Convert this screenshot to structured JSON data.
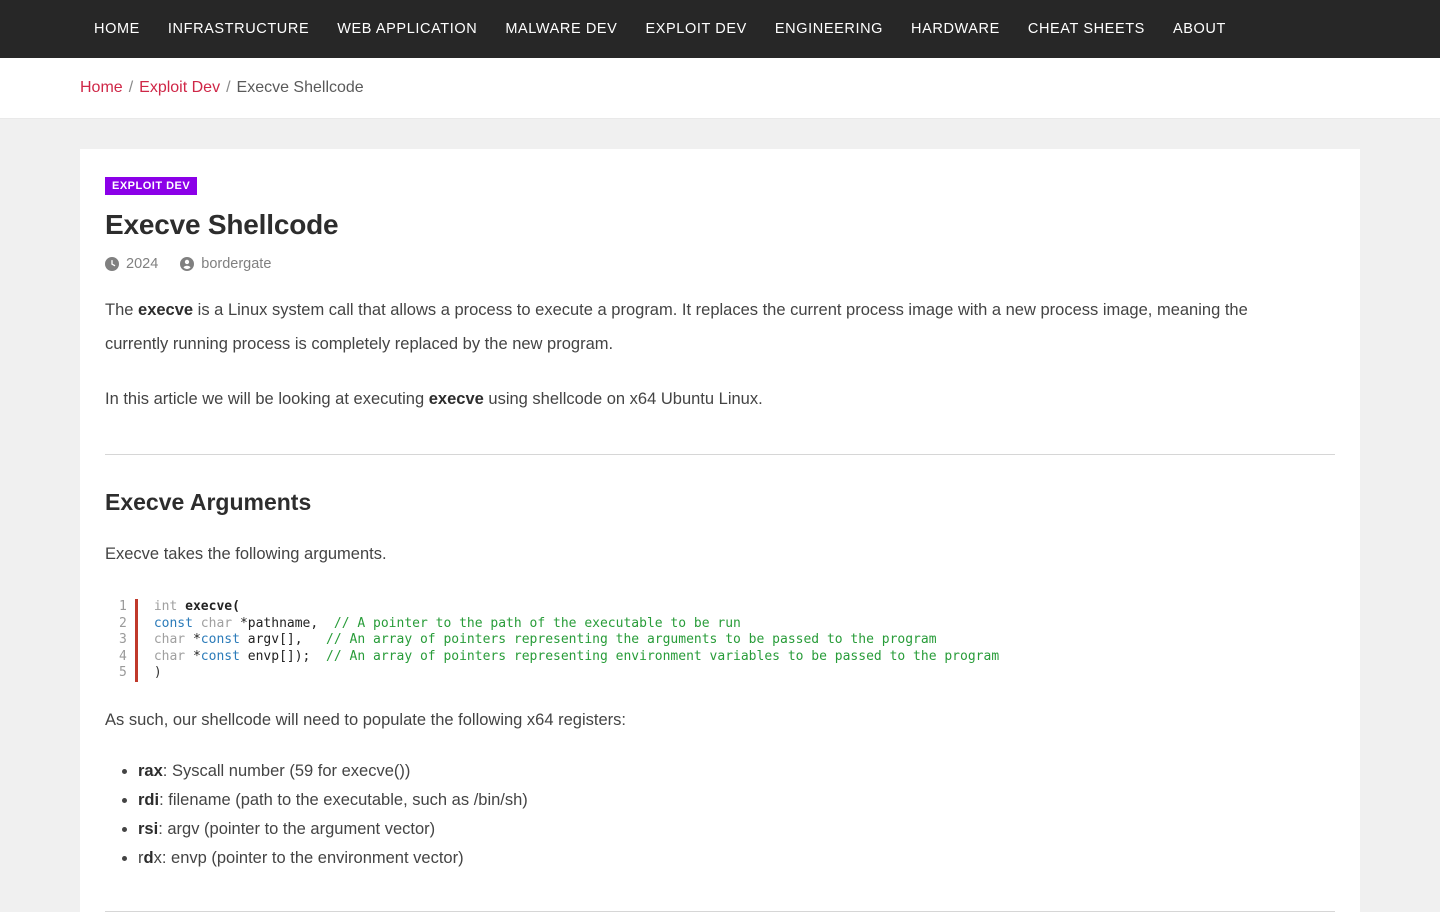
{
  "nav": {
    "items": [
      {
        "label": "Home",
        "name": "nav-item-home"
      },
      {
        "label": "Infrastructure",
        "name": "nav-item-infrastructure"
      },
      {
        "label": "Web Application",
        "name": "nav-item-web-application"
      },
      {
        "label": "Malware Dev",
        "name": "nav-item-malware-dev"
      },
      {
        "label": "Exploit Dev",
        "name": "nav-item-exploit-dev"
      },
      {
        "label": "Engineering",
        "name": "nav-item-engineering"
      },
      {
        "label": "Hardware",
        "name": "nav-item-hardware"
      },
      {
        "label": "Cheat Sheets",
        "name": "nav-item-cheat-sheets"
      },
      {
        "label": "About",
        "name": "nav-item-about"
      }
    ]
  },
  "breadcrumb": {
    "home": "Home",
    "sep1": "/",
    "category": "Exploit Dev",
    "sep2": "/",
    "current": "Execve Shellcode"
  },
  "article": {
    "badge": "EXPLOIT DEV",
    "title": "Execve Shellcode",
    "meta": {
      "date_icon": "clock-icon",
      "date": "2024",
      "author_icon": "user-icon",
      "author": "bordergate"
    },
    "intro": {
      "p1_a": "The ",
      "p1_b": "execve",
      "p1_c": " is a Linux system call that allows a process to execute a program. It replaces the current process image with a new process image, meaning the currently running process is completely replaced by the new program.",
      "p2_a": "In this article we will be looking at executing ",
      "p2_b": "execve",
      "p2_c": " using shellcode on x64 Ubuntu Linux."
    },
    "section": {
      "heading": "Execve Arguments",
      "lead": "Execve takes the following arguments.",
      "code": {
        "line_numbers": [
          "1",
          "2",
          "3",
          "4",
          "5"
        ],
        "lines": [
          [
            {
              "t": "int ",
              "c": "type"
            },
            {
              "t": "execve(",
              "c": "fn"
            }
          ],
          [
            {
              "t": "const ",
              "c": "kw"
            },
            {
              "t": "char ",
              "c": "type"
            },
            {
              "t": "*pathname,",
              "c": "var"
            },
            {
              "t": "  ",
              "c": "plain"
            },
            {
              "t": "// A pointer to the path of the executable to be run",
              "c": "comment"
            }
          ],
          [
            {
              "t": "char ",
              "c": "type"
            },
            {
              "t": "*",
              "c": "var"
            },
            {
              "t": "const ",
              "c": "kw"
            },
            {
              "t": "argv[],",
              "c": "var"
            },
            {
              "t": "   ",
              "c": "plain"
            },
            {
              "t": "// An array of pointers representing the arguments to be passed to the program",
              "c": "comment"
            }
          ],
          [
            {
              "t": "char ",
              "c": "type"
            },
            {
              "t": "*",
              "c": "var"
            },
            {
              "t": "const ",
              "c": "kw"
            },
            {
              "t": "envp[]);",
              "c": "var"
            },
            {
              "t": "  ",
              "c": "plain"
            },
            {
              "t": "// An array of pointers representing environment variables to be passed to the program",
              "c": "comment"
            }
          ],
          [
            {
              "t": ")",
              "c": "plain"
            }
          ]
        ]
      },
      "after_code": "As such, our shellcode will need to populate the following x64 registers:",
      "registers": [
        {
          "bold_pre": "",
          "bold": "rax",
          "post": ": Syscall number (59 for execve())"
        },
        {
          "bold_pre": "",
          "bold": "rdi",
          "post": ": filename (path to the executable, such as /bin/sh)"
        },
        {
          "bold_pre": "",
          "bold": "rsi",
          "post": ": argv (pointer to the argument vector)"
        },
        {
          "bold_pre": "r",
          "bold": "d",
          "post": "x: envp (pointer to the environment vector)"
        }
      ]
    }
  },
  "colors": {
    "nav_bg": "#272727",
    "page_bg": "#f0f0f0",
    "card_bg": "#ffffff",
    "link": "#cf2747",
    "badge": "#8b00e8",
    "code_accent": "#c0392b",
    "code_comment": "#289c39",
    "code_keyword": "#2b7bb9"
  }
}
